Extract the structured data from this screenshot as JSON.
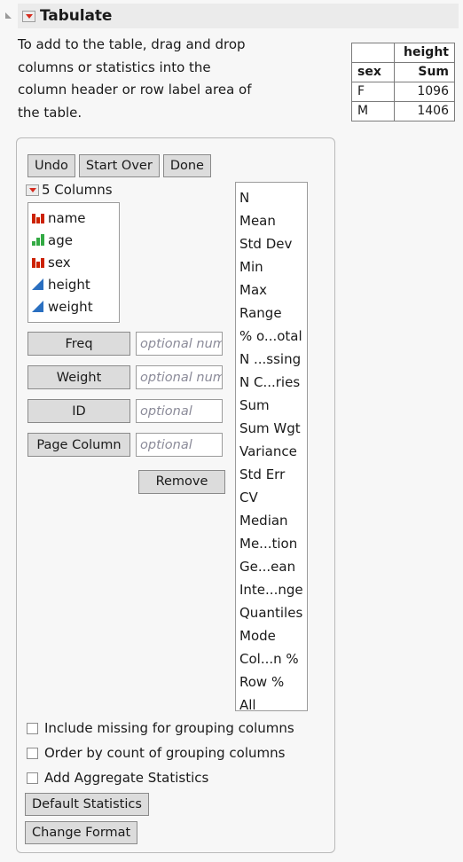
{
  "window": {
    "title": "Tabulate",
    "disclosure_icon": "triangle-collapse-icon",
    "menu_icon": "red-triangle-menu-icon"
  },
  "instructions": {
    "line1": "To add to the table, drag and drop",
    "line2": "columns or statistics into the",
    "line3": "column header or row label area of",
    "line4": "the table."
  },
  "output_table": {
    "corner_blank": "",
    "column_group_header": "height",
    "row_label_header": "sex",
    "stat_header": "Sum",
    "rows": [
      {
        "label": "F",
        "value": "1096"
      },
      {
        "label": "M",
        "value": "1406"
      }
    ]
  },
  "toolbar": {
    "undo_label": "Undo",
    "start_over_label": "Start Over",
    "done_label": "Done"
  },
  "columns_panel": {
    "menu_icon": "red-triangle-menu-icon",
    "header_label": "5 Columns",
    "items": [
      {
        "name": "name",
        "type": "nominal",
        "icon": "nominal-red-bars-icon"
      },
      {
        "name": "age",
        "type": "ordinal",
        "icon": "ordinal-green-bars-icon"
      },
      {
        "name": "sex",
        "type": "nominal",
        "icon": "nominal-red-bars-icon"
      },
      {
        "name": "height",
        "type": "continuous",
        "icon": "continuous-blue-triangle-icon"
      },
      {
        "name": "weight",
        "type": "continuous",
        "icon": "continuous-blue-triangle-icon"
      }
    ]
  },
  "drop_zones": [
    {
      "button_label": "Freq",
      "placeholder": "optional numeric"
    },
    {
      "button_label": "Weight",
      "placeholder": "optional numeric"
    },
    {
      "button_label": "ID",
      "placeholder": "optional"
    },
    {
      "button_label": "Page Column",
      "placeholder": "optional"
    }
  ],
  "remove_label": "Remove",
  "statistics": [
    "N",
    "Mean",
    "Std Dev",
    "Min",
    "Max",
    "Range",
    "% o...otal",
    "N ...ssing",
    "N C...ries",
    "Sum",
    "Sum Wgt",
    "Variance",
    "Std Err",
    "CV",
    "Median",
    "Me...tion",
    "Ge...ean",
    "Inte...nge",
    "Quantiles",
    "Mode",
    "Col...n %",
    "Row %",
    "All"
  ],
  "options": [
    {
      "label": "Include missing for grouping columns",
      "checked": false
    },
    {
      "label": "Order by count of grouping columns",
      "checked": false
    },
    {
      "label": "Add Aggregate Statistics",
      "checked": false
    }
  ],
  "bottom_buttons": {
    "default_statistics_label": "Default Statistics",
    "change_format_label": "Change Format"
  },
  "colors": {
    "background": "#f7f7f7",
    "titlebar": "#ebebeb",
    "button_face": "#dcdcdc",
    "nominal_icon": "#cc2200",
    "ordinal_icon": "#33aa44",
    "continuous_icon": "#2a6fc0",
    "hotspot_triangle": "#d52b1e",
    "placeholder_text": "#8b8b99"
  }
}
